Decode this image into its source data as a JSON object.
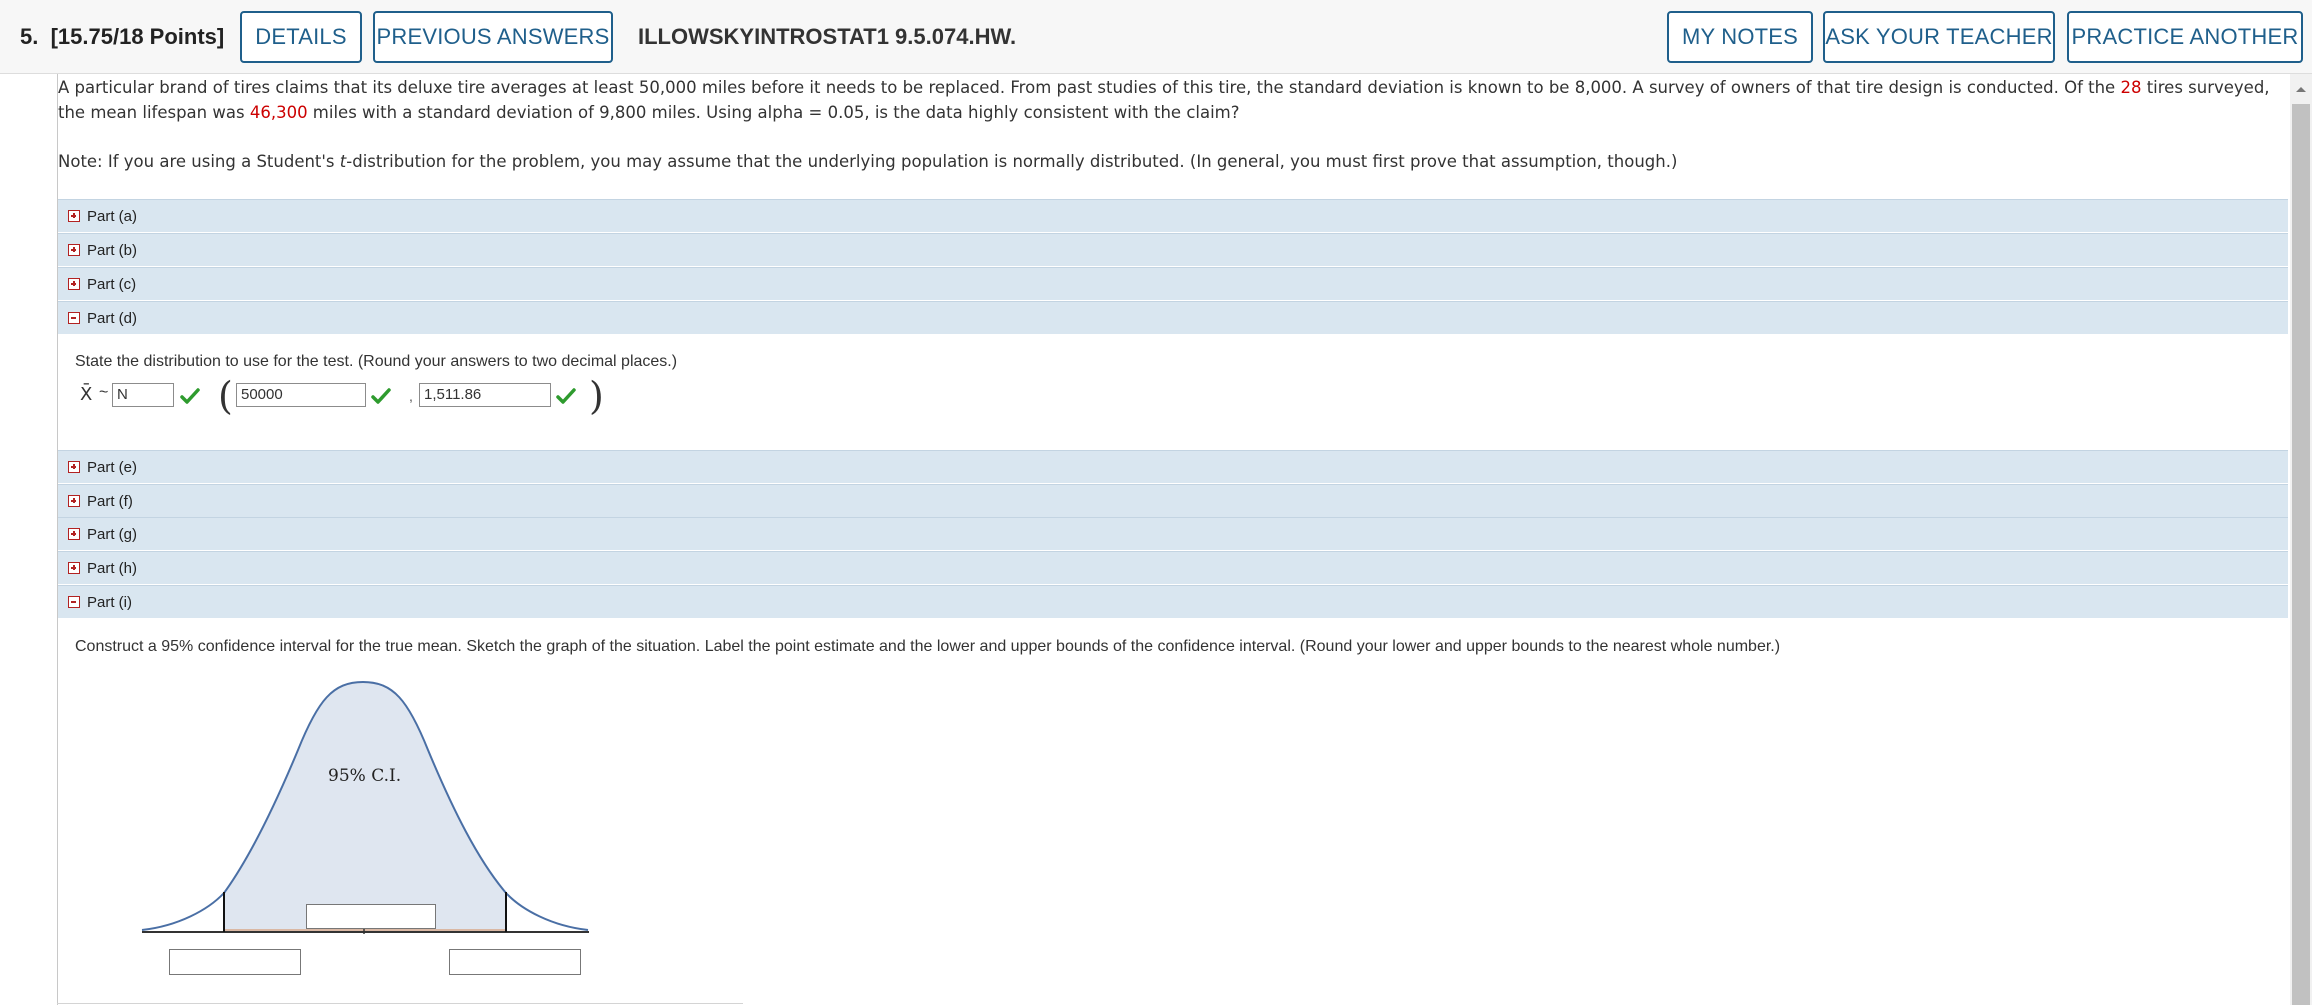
{
  "header": {
    "question_number": "5.",
    "points": "[15.75/18 Points]",
    "details_label": "DETAILS",
    "previous_answers_label": "PREVIOUS ANSWERS",
    "assignment_code": "ILLOWSKYINTROSTAT1 9.5.074.HW.",
    "my_notes_label": "MY NOTES",
    "ask_teacher_label": "ASK YOUR TEACHER",
    "practice_another_label": "PRACTICE ANOTHER"
  },
  "problem": {
    "text_1": "A particular brand of tires claims that its deluxe tire averages at least 50,000 miles before it needs to be replaced. From past studies of this tire, the standard deviation is known to be 8,000. A survey of owners of that tire design is conducted. Of the ",
    "tires_surveyed": "28",
    "text_2": " tires surveyed, the mean lifespan was ",
    "mean_lifespan": "46,300",
    "text_3": " miles with a standard deviation of 9,800 miles. Using alpha = 0.05, is the data highly consistent with the claim?",
    "note_1": "Note: If you are using a Student's ",
    "note_t": "t",
    "note_2": "-distribution for the problem, you may assume that the underlying population is normally distributed. (In general, you must first prove that assumption, though.)"
  },
  "parts": [
    {
      "label": "Part (a)",
      "expanded": false
    },
    {
      "label": "Part (b)",
      "expanded": false
    },
    {
      "label": "Part (c)",
      "expanded": false
    },
    {
      "label": "Part (d)",
      "expanded": true
    },
    {
      "label": "Part (e)",
      "expanded": false
    },
    {
      "label": "Part (f)",
      "expanded": false
    },
    {
      "label": "Part (g)",
      "expanded": false
    },
    {
      "label": "Part (h)",
      "expanded": false
    },
    {
      "label": "Part (i)",
      "expanded": true
    }
  ],
  "part_d": {
    "instruction": "State the distribution to use for the test. (Round your answers to two decimal places.)",
    "xbar_symbol": "X̄",
    "tilde": "~",
    "distribution_value": "N",
    "mean_value": "50000",
    "comma": ",",
    "sd_value": "1,511.86",
    "open_paren": "(",
    "close_paren": ")"
  },
  "part_i": {
    "instruction": "Construct a 95% confidence interval for the true mean. Sketch the graph of the situation. Label the point estimate and the lower and upper bounds of the confidence interval. (Round your lower and upper bounds to the nearest whole number.)",
    "ci_label": "95% C.I.",
    "point_estimate_value": "",
    "lower_bound_value": "",
    "upper_bound_value": ""
  },
  "colors": {
    "accent": "#1f5f8b",
    "part_bar": "#d9e6f0",
    "highlight_red": "#cc0000",
    "check_green": "#2e9b2e",
    "curve_fill": "#dfe6f0",
    "curve_stroke": "#4a6fa5"
  }
}
